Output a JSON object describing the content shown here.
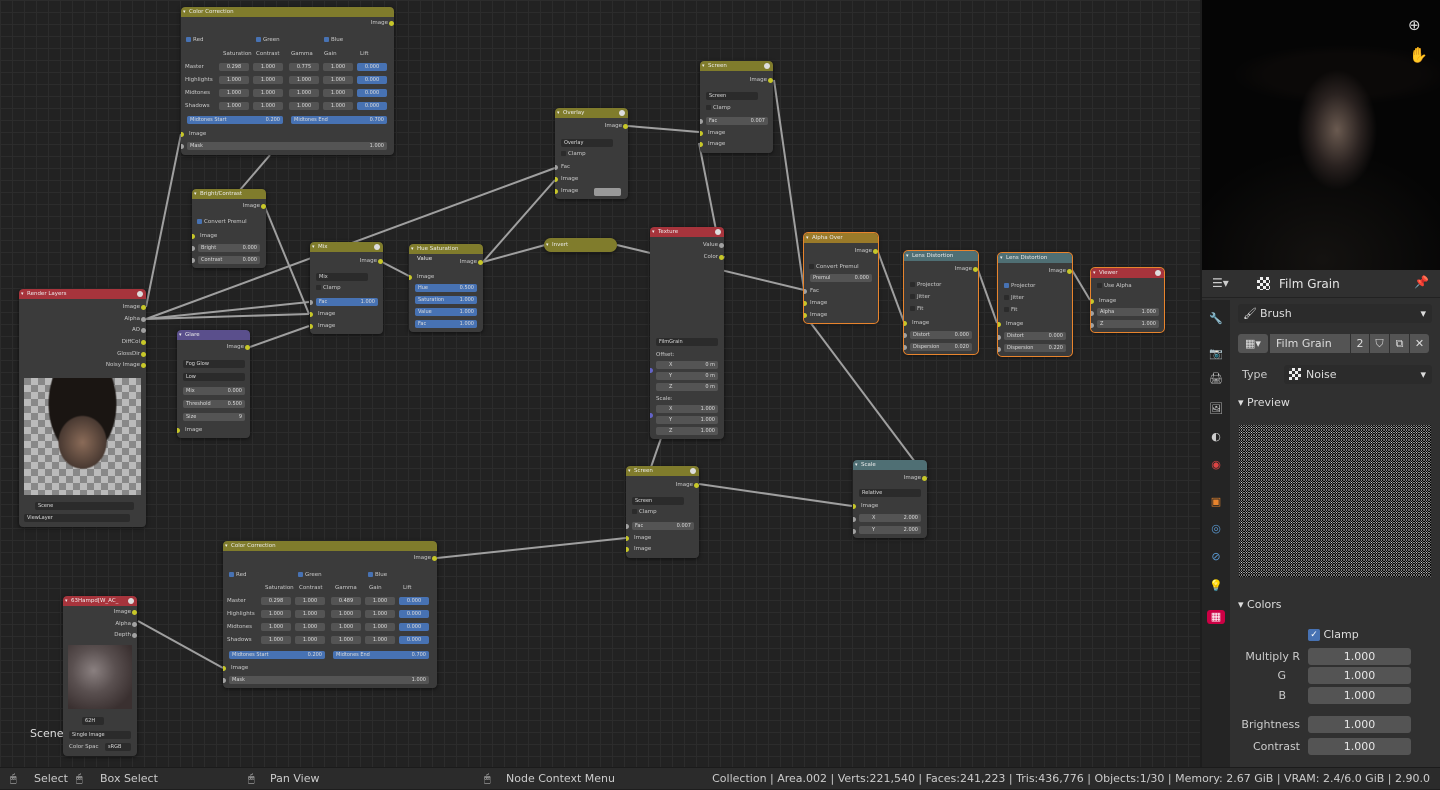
{
  "nodes": {
    "cc_top": {
      "title": "Color Correction",
      "out_image": "Image",
      "red": "Red",
      "green": "Green",
      "blue": "Blue",
      "cols": [
        "Saturation",
        "Contrast",
        "Gamma",
        "Gain",
        "Lift"
      ],
      "rows": [
        {
          "label": "Master",
          "vals": [
            "0.298",
            "1.000",
            "0.775",
            "1.000",
            "0.000"
          ]
        },
        {
          "label": "Highlights",
          "vals": [
            "1.000",
            "1.000",
            "1.000",
            "1.000",
            "0.000"
          ]
        },
        {
          "label": "Midtones",
          "vals": [
            "1.000",
            "1.000",
            "1.000",
            "1.000",
            "0.000"
          ]
        },
        {
          "label": "Shadows",
          "vals": [
            "1.000",
            "1.000",
            "1.000",
            "1.000",
            "0.000"
          ]
        }
      ],
      "mid_start": "Midtones Start",
      "mid_start_val": "0.200",
      "mid_end": "Midtones End",
      "mid_end_val": "0.700",
      "in_image": "Image",
      "mask": "Mask",
      "mask_val": "1.000"
    },
    "bc": {
      "title": "Bright/Contrast",
      "out_image": "Image",
      "convert": "Convert Premul",
      "in_image": "Image",
      "bright": "Bright",
      "bright_val": "0.000",
      "contrast": "Contrast",
      "contrast_val": "0.000"
    },
    "rl": {
      "title": "Render Layers",
      "outs": [
        "Image",
        "Alpha",
        "AO",
        "DiffCol",
        "GlossDir",
        "Noisy Image"
      ],
      "scene": "Scene",
      "viewlayer": "ViewLayer"
    },
    "glare": {
      "title": "Glare",
      "out_image": "Image",
      "type": "Fog Glow",
      "quality": "Low",
      "mix": "Mix",
      "mix_val": "0.000",
      "threshold": "Threshold",
      "threshold_val": "0.500",
      "size": "Size",
      "size_val": "9",
      "in_image": "Image"
    },
    "mix": {
      "title": "Mix",
      "out_image": "Image",
      "mode": "Mix",
      "clamp": "Clamp",
      "fac": "Fac",
      "fac_val": "1.000",
      "in1": "Image",
      "in2": "Image"
    },
    "hsv": {
      "title": "Hue Saturation Value",
      "out_image": "Image",
      "in_image": "Image",
      "hue": "Hue",
      "hue_val": "0.500",
      "sat": "Saturation",
      "sat_val": "1.000",
      "val": "Value",
      "val_val": "1.000",
      "fac": "Fac",
      "fac_val": "1.000"
    },
    "overlay": {
      "title": "Overlay",
      "out_image": "Image",
      "mode": "Overlay",
      "clamp": "Clamp",
      "fac": "Fac",
      "in1": "Image",
      "in2": "Image"
    },
    "invert": {
      "title": "Invert"
    },
    "screen_top": {
      "title": "Screen",
      "out_image": "Image",
      "mode": "Screen",
      "clamp": "Clamp",
      "fac": "Fac",
      "fac_val": "0.007",
      "in1": "Image",
      "in2": "Image"
    },
    "texture": {
      "title": "Texture",
      "out_value": "Value",
      "out_color": "Color",
      "tex": "FilmGrain",
      "offset": "Offset:",
      "x": "X",
      "x_val": "0 m",
      "y": "Y",
      "y_val": "0 m",
      "z": "Z",
      "z_val": "0 m",
      "scale": "Scale:",
      "sx_val": "1.000",
      "sy_val": "1.000",
      "sz_val": "1.000"
    },
    "alpha_over": {
      "title": "Alpha Over",
      "out_image": "Image",
      "convert": "Convert Premul",
      "premul": "Premul",
      "premul_val": "0.000",
      "fac": "Fac",
      "in1": "Image",
      "in2": "Image"
    },
    "lens1": {
      "title": "Lens Distortion",
      "out_image": "Image",
      "projector": "Projector",
      "jitter": "Jitter",
      "fit": "Fit",
      "in_image": "Image",
      "distort": "Distort",
      "distort_val": "0.000",
      "disp": "Dispersion",
      "disp_val": "0.020"
    },
    "lens2": {
      "title": "Lens Distortion",
      "out_image": "Image",
      "projector": "Projector",
      "jitter": "Jitter",
      "fit": "Fit",
      "in_image": "Image",
      "distort": "Distort",
      "distort_val": "0.000",
      "disp": "Dispersion",
      "disp_val": "0.220"
    },
    "viewer": {
      "title": "Viewer",
      "use_alpha": "Use Alpha",
      "in_image": "Image",
      "alpha": "Alpha",
      "alpha_val": "1.000",
      "z": "Z",
      "z_val": "1.000"
    },
    "screen_mid": {
      "title": "Screen",
      "out_image": "Image",
      "mode": "Screen",
      "clamp": "Clamp",
      "fac": "Fac",
      "fac_val": "0.007",
      "in1": "Image",
      "in2": "Image"
    },
    "scale": {
      "title": "Scale",
      "out_image": "Image",
      "mode": "Relative",
      "in_image": "Image",
      "x": "X",
      "x_val": "2.000",
      "y": "Y",
      "y_val": "2.000"
    },
    "cc_bot": {
      "title": "Color Correction",
      "out_image": "Image",
      "red": "Red",
      "green": "Green",
      "blue": "Blue",
      "cols": [
        "Saturation",
        "Contrast",
        "Gamma",
        "Gain",
        "Lift"
      ],
      "rows": [
        {
          "label": "Master",
          "vals": [
            "0.298",
            "1.000",
            "0.489",
            "1.000",
            "0.000"
          ]
        },
        {
          "label": "Highlights",
          "vals": [
            "1.000",
            "1.000",
            "1.000",
            "1.000",
            "0.000"
          ]
        },
        {
          "label": "Midtones",
          "vals": [
            "1.000",
            "1.000",
            "1.000",
            "1.000",
            "0.000"
          ]
        },
        {
          "label": "Shadows",
          "vals": [
            "1.000",
            "1.000",
            "1.000",
            "1.000",
            "0.000"
          ]
        }
      ],
      "mid_start": "Midtones Start",
      "mid_start_val": "0.200",
      "mid_end": "Midtones End",
      "mid_end_val": "0.700",
      "in_image": "Image",
      "mask": "Mask",
      "mask_val": "1.000"
    },
    "img": {
      "title": "63Hampd[W_AC_",
      "outs": [
        "Image",
        "Alpha",
        "Depth"
      ],
      "num": "62H",
      "source": "Single Image",
      "colorspace": "Color Spac",
      "colorspace_val": "sRGB"
    }
  },
  "scene_label": "Scene",
  "panel": {
    "texture_name": "Film Grain",
    "context": "Brush",
    "datablock": "Film Grain",
    "users": "2",
    "type_label": "Type",
    "type_val": "Noise",
    "preview_label": "Preview",
    "colors_label": "Colors",
    "clamp": "Clamp",
    "multiply_r": "Multiply R",
    "g": "G",
    "b": "B",
    "brightness": "Brightness",
    "contrast": "Contrast",
    "r_val": "1.000",
    "g_val": "1.000",
    "b_val": "1.000",
    "brightness_val": "1.000",
    "contrast_val": "1.000"
  },
  "status": {
    "select": "Select",
    "box_select": "Box Select",
    "pan_view": "Pan View",
    "context_menu": "Node Context Menu",
    "stats": "Collection | Area.002 | Verts:221,540 | Faces:241,223 | Tris:436,776 | Objects:1/30 | Memory: 2.67 GiB | VRAM: 2.4/6.0 GiB | 2.90.0"
  },
  "colors": {
    "accent": "#4772b3",
    "socket_yellow": "#c7c729",
    "selected": "#e8842d"
  }
}
